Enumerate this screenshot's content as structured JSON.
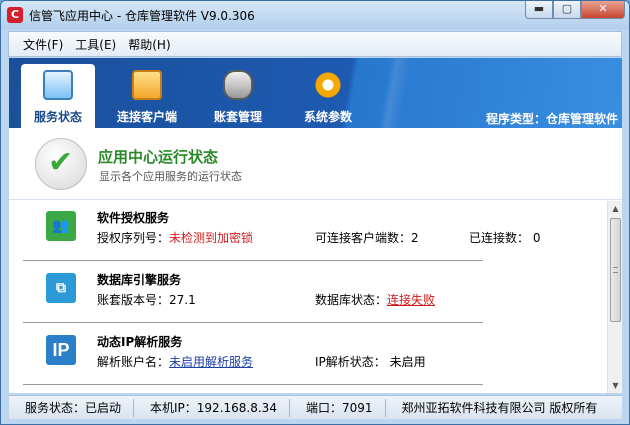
{
  "window": {
    "title": "信管飞应用中心 - 仓库管理软件 V9.0.306",
    "minimize": "▬",
    "maximize": "▢",
    "close": "✕"
  },
  "menu": [
    {
      "label": "文件(F)"
    },
    {
      "label": "工具(E)"
    },
    {
      "label": "帮助(H)"
    }
  ],
  "tabs": [
    {
      "label": "服务状态",
      "icon": "monitor-icon",
      "active": true
    },
    {
      "label": "连接客户端",
      "icon": "users-icon",
      "active": false
    },
    {
      "label": "账套管理",
      "icon": "database-icon",
      "active": false
    },
    {
      "label": "系统参数",
      "icon": "gear-icon",
      "active": false
    }
  ],
  "program_type": "程序类型：仓库管理软件",
  "status_header": {
    "title": "应用中心运行状态",
    "subtitle": "显示各个应用服务的运行状态"
  },
  "services": [
    {
      "name": "软件授权服务",
      "icon": "users-icon",
      "row": {
        "label": "授权序列号：",
        "value": "未检测到加密锁"
      },
      "col2": "可连接客户端数：2",
      "col3": "已连接数：  0"
    },
    {
      "name": "数据库引擎服务",
      "icon": "database-engine-icon",
      "row": {
        "label": "账套版本号：",
        "value": "27.1"
      },
      "col2": {
        "label": "数据库状态：",
        "value": "连接失败"
      }
    },
    {
      "name": "动态IP解析服务",
      "icon": "ip-icon",
      "icon_text": "IP",
      "row": {
        "label": "解析账户名：",
        "value": "未启用解析服务"
      },
      "col2": "IP解析状态：  未启用"
    }
  ],
  "statusbar": {
    "service_status": "服务状态：已启动",
    "local_ip": "本机IP：192.168.8.34",
    "port": "端口：7091",
    "copyright": "郑州亚拓软件科技有限公司 版权所有"
  },
  "colors": {
    "header_blue": "#1d5ab0",
    "ok_green": "#2a8a2a",
    "error_red": "#d01c1c",
    "link_blue": "#1a3fa8"
  }
}
